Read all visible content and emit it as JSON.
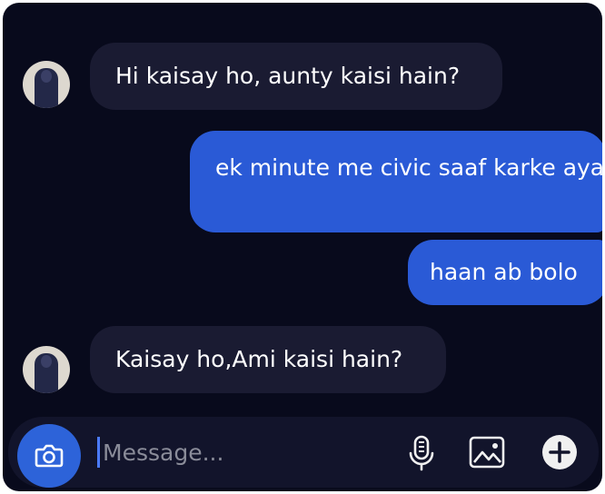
{
  "messages": [
    {
      "id": "msg1",
      "direction": "incoming",
      "text": "Hi kaisay ho, aunty kaisi hain?"
    },
    {
      "id": "msg2",
      "direction": "outgoing",
      "text": "ek minute me civic saaf karke aya"
    },
    {
      "id": "msg3",
      "direction": "outgoing",
      "text": "haan ab bolo"
    },
    {
      "id": "msg4",
      "direction": "incoming",
      "text": "Kaisay ho,Ami kaisi hain?"
    }
  ],
  "composer": {
    "placeholder": "Message...",
    "icons": [
      "camera-icon",
      "microphone-icon",
      "gallery-icon",
      "plus-icon"
    ]
  },
  "colors": {
    "background": "#080a1c",
    "incoming_bubble": "#1a1b32",
    "outgoing_bubble": "#2a5ad6",
    "accent": "#2d63d9"
  }
}
